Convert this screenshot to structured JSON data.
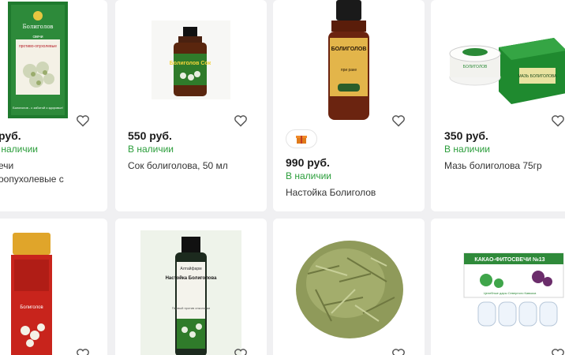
{
  "products_row1": [
    {
      "price": "руб.",
      "stock": "В наличии",
      "title_line1": "ечи",
      "title_line2": "оопухолевые с",
      "image": {
        "brand": "Болиголов",
        "kind": "свечи",
        "kind2": "противо-опухолевые",
        "footer": "Болиголов - с заботой о здоровье!"
      }
    },
    {
      "price": "550 руб.",
      "stock": "В наличии",
      "title_line1": "Сок болиголова, 50 мл",
      "image": {
        "label": "Болиголов Сок"
      }
    },
    {
      "price": "990 руб.",
      "stock": "В наличии",
      "title_line1": "Настойка Болиголов",
      "gift_icon": "gift-icon",
      "image": {
        "label": "БОЛИГОЛОВ",
        "sub": "при раке"
      }
    },
    {
      "price": "350 руб.",
      "stock": "В наличии",
      "title_line1": "Мазь болиголова 75гр",
      "image": {
        "jar": "БОЛИГОЛОВ",
        "box": "МАЗЬ БОЛИГОЛОВА"
      }
    }
  ],
  "products_row2": [
    {
      "image": {
        "label": "Болиголов"
      }
    },
    {
      "image": {
        "brand": "Алтайфарм",
        "label": "Настойка Болиголова",
        "sub": "Первый против онкологии"
      }
    },
    {
      "image": {
        "kind": "dried herb"
      }
    },
    {
      "image": {
        "label": "КАКАО-ФИТОСВЕЧИ №13",
        "sub": "Целебные дары Северного Кавказа"
      }
    }
  ],
  "icons": {
    "favorite": "heart-icon",
    "gift": "gift-icon"
  },
  "colors": {
    "in_stock": "#2a9d3a",
    "page_bg": "#f0f0f2",
    "card_bg": "#ffffff"
  }
}
